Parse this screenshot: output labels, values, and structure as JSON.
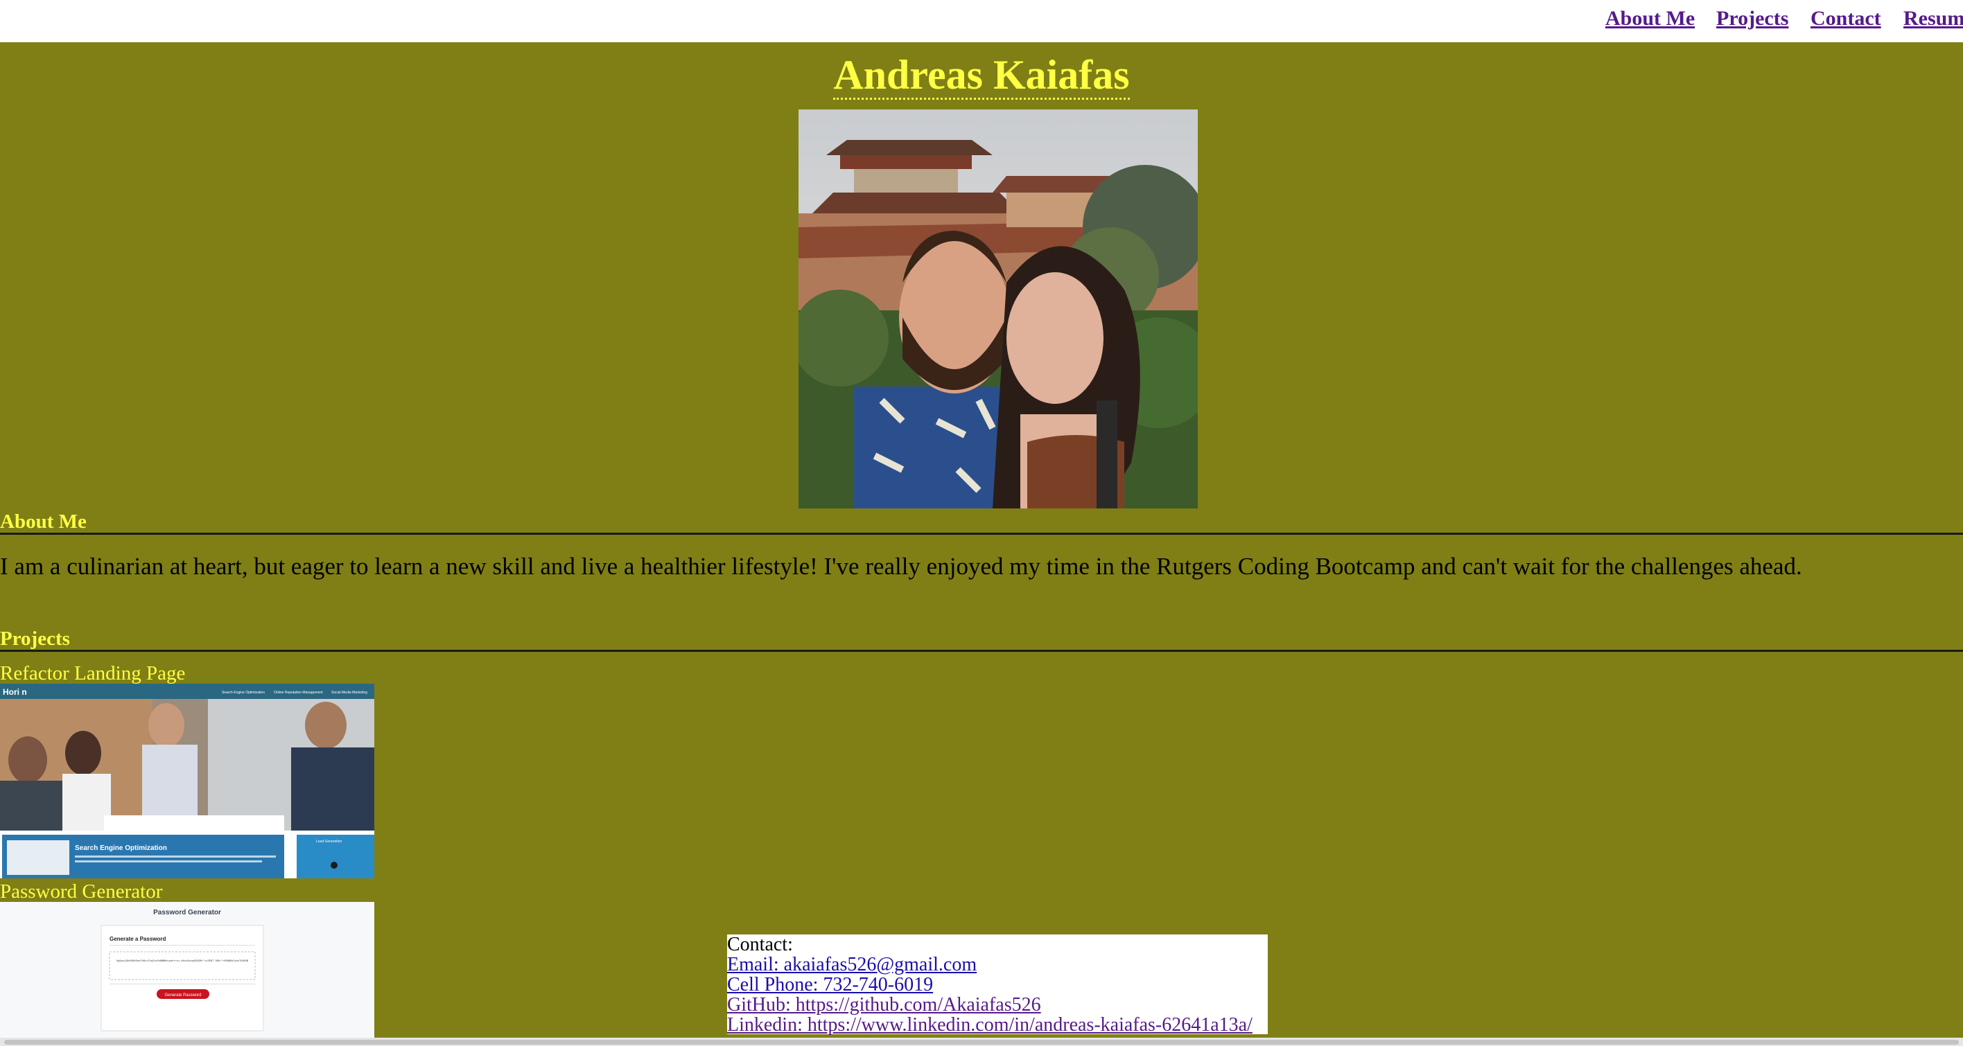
{
  "nav": {
    "links": [
      "About Me",
      "Projects",
      "Contact",
      "Resum"
    ]
  },
  "header": {
    "title": "Andreas Kaiafas"
  },
  "about": {
    "heading": "About Me",
    "text": "I am a culinarian at heart, but eager to learn a new skill and live a healthier lifestyle! I've really enjoyed my time in the Rutgers Coding Bootcamp and can't wait for the challenges ahead."
  },
  "projects": {
    "heading": "Projects",
    "items": [
      {
        "title": "Refactor Landing Page",
        "screenshot": {
          "brand": "Hori  n",
          "nav": [
            "Search Engine Optimization",
            "Online Reputation Management",
            "Social Media Marketing"
          ],
          "section_title": "Search Engine Optimization",
          "side_title": "Lead Generation"
        }
      },
      {
        "title": "Password Generator",
        "screenshot": {
          "header": "Password Generator",
          "card_title": "Generate a Password",
          "password": "8q8ps(89nX8Ht5mxTh$rsTkaZixUh6MNMtnpoh+rvu.c8ssGuicpENO30+'ci3E8T 300/*+096BOdfykoTGiBSB",
          "button": "Generate Password"
        }
      }
    ]
  },
  "contact": {
    "heading": "Contact:",
    "email": "Email: akaiafas526@gmail.com",
    "phone": "Cell Phone: 732-740-6019",
    "github": "GitHub: https://github.com/Akaiafas526",
    "linkedin": "Linkedin: https://www.linkedin.com/in/andreas-kaiafas-62641a13a/"
  },
  "colors": {
    "page_background": "#7f7f16",
    "accent_text": "#ffff44",
    "nav_link": "#551a8b",
    "contact_link": "#1a0dab"
  }
}
